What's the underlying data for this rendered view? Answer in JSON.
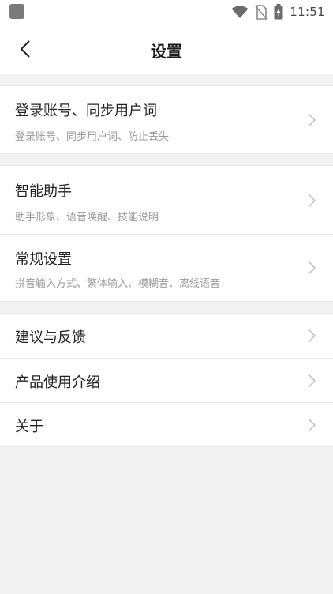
{
  "status_bar": {
    "time": "11:51",
    "icons": [
      "app-icon",
      "wifi-icon",
      "no-sim-icon",
      "battery-charging-icon"
    ]
  },
  "header": {
    "title": "设置",
    "back_icon": "chevron-left-icon"
  },
  "groups": [
    {
      "items": [
        {
          "title": "登录账号、同步用户词",
          "subtitle": "登录账号、同步用户词、防止丢失"
        }
      ]
    },
    {
      "items": [
        {
          "title": "智能助手",
          "subtitle": "助手形象、语音唤醒、技能说明"
        },
        {
          "title": "常规设置",
          "subtitle": "拼音输入方式、繁体输入、模糊音、离线语音"
        }
      ]
    },
    {
      "items": [
        {
          "title": "建议与反馈"
        },
        {
          "title": "产品使用介绍"
        },
        {
          "title": "关于"
        }
      ]
    }
  ],
  "colors": {
    "background": "#f2f2f2",
    "surface": "#ffffff",
    "text_primary": "#222222",
    "text_secondary": "#9a9a9a",
    "chevron": "#c4c4c4"
  }
}
